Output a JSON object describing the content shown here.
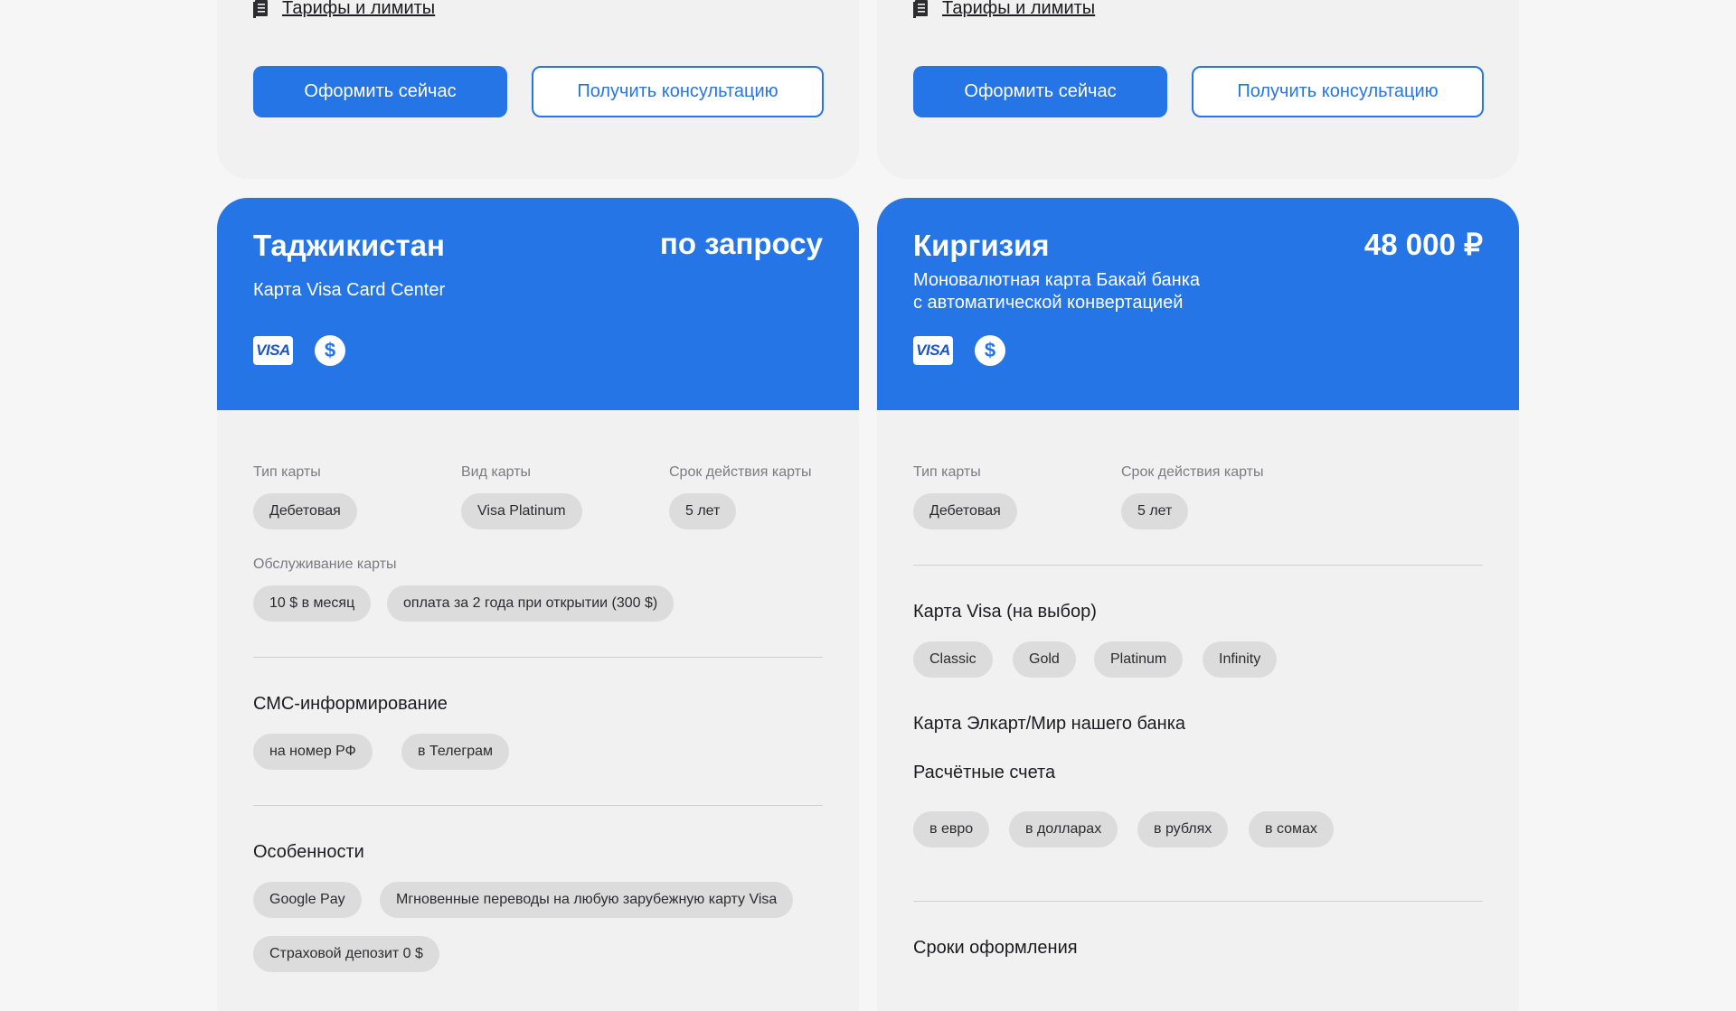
{
  "top_cards": {
    "left": {
      "tariffs_link": "Тарифы и лимиты",
      "primary_button": "Оформить сейчас",
      "secondary_button": "Получить консультацию"
    },
    "right": {
      "tariffs_link": "Тарифы и лимиты",
      "primary_button": "Оформить сейчас",
      "secondary_button": "Получить консультацию"
    }
  },
  "tajikistan": {
    "country": "Таджикистан",
    "price": "по запросу",
    "subtitle": "Карта Visa Card Center",
    "icons": [
      "visa-icon",
      "dollar-icon"
    ],
    "visa_text": "VISA",
    "dollar_text": "$",
    "card_type_label": "Тип карты",
    "card_type": "Дебетовая",
    "card_kind_label": "Вид карты",
    "card_kind": "Visa Platinum",
    "validity_label": "Срок действия карты",
    "validity": "5 лет",
    "service_label": "Обслуживание карты",
    "service": [
      "10 $ в месяц",
      "оплата за 2 года при открытии (300 $)"
    ],
    "sms_title": "СМС-информирование",
    "sms": [
      "на номер РФ",
      "в Телеграм"
    ],
    "features_title": "Особенности",
    "features": [
      "Google Pay",
      "Мгновенные переводы на любую зарубежную карту Visa",
      "Страховой депозит 0 $"
    ]
  },
  "kyrgyzstan": {
    "country": "Киргизия",
    "price": "48 000 ₽",
    "subtitle_line1": "Моновалютная карта Бакай банка",
    "subtitle_line2": "с автоматической конвертацией",
    "icons": [
      "visa-icon",
      "dollar-icon"
    ],
    "visa_text": "VISA",
    "dollar_text": "$",
    "card_type_label": "Тип карты",
    "card_type": "Дебетовая",
    "validity_label": "Срок действия карты",
    "validity": "5 лет",
    "visa_choice_title": "Карта Visa (на выбор)",
    "visa_choices": [
      "Classic",
      "Gold",
      "Platinum",
      "Infinity"
    ],
    "elcart_title": "Карта Элкарт/Мир нашего банка",
    "accounts_title": "Расчётные счета",
    "accounts": [
      "в евро",
      "в долларах",
      "в рублях",
      "в сомах"
    ],
    "terms_title": "Сроки оформления"
  },
  "colors": {
    "accent": "#2575e6",
    "page_bg": "#f6f6f7",
    "card_bg": "#f1f1f2",
    "chip_bg": "#dcdcdd"
  }
}
